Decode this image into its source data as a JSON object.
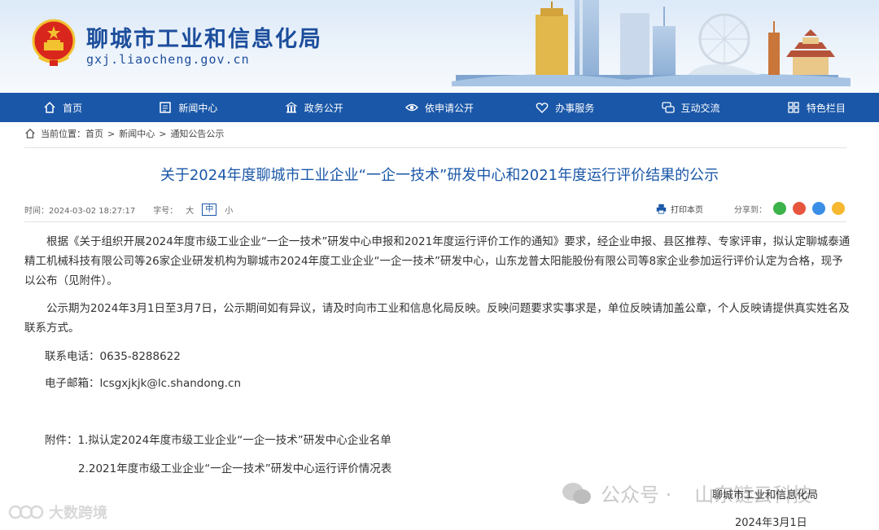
{
  "header": {
    "site_title": "聊城市工业和信息化局",
    "domain": "gxj.liaocheng.gov.cn"
  },
  "nav": [
    {
      "label": "首页",
      "icon": "home-icon"
    },
    {
      "label": "新闻中心",
      "icon": "newspaper-icon"
    },
    {
      "label": "政务公开",
      "icon": "government-icon"
    },
    {
      "label": "依申请公开",
      "icon": "eye-icon"
    },
    {
      "label": "办事服务",
      "icon": "heart-icon"
    },
    {
      "label": "互动交流",
      "icon": "chat-icon"
    },
    {
      "label": "特色栏目",
      "icon": "grid-icon"
    }
  ],
  "breadcrumb": {
    "prefix": "当前位置：",
    "items": [
      "首页",
      "新闻中心",
      "通知公告公示"
    ],
    "separator": ">"
  },
  "article": {
    "title": "关于2024年度聊城市工业企业“一企一技术”研发中心和2021年度运行评价结果的公示",
    "time": "时间：2024-03-02 18:27:17",
    "font_label": "字号：",
    "font_sizes": [
      "大",
      "中",
      "小"
    ],
    "print_label": "打印本页",
    "share_label": "分享到：",
    "share_icons": [
      "wechat-icon",
      "weibo-icon",
      "qq-icon",
      "qzone-icon"
    ],
    "paragraph1": "根据《关于组织开展2024年度市级工业企业“一企一技术”研发中心申报和2021年度运行评价工作的通知》要求，经企业申报、县区推荐、专家评审，拟认定聊城泰通精工机械科技有限公司等26家企业研发机构为聊城市2024年度工业企业“一企一技术”研发中心，山东龙普太阳能股份有限公司等8家企业参加运行评价认定为合格，现予以公布（见附件）。",
    "paragraph2": "公示期为2024年3月1日至3月7日，公示期间如有异议，请及时向市工业和信息化局反映。反映问题要求实事求是，单位反映请加盖公章，个人反映请提供真实姓名及联系方式。",
    "phone": "联系电话：0635-8288622",
    "email": "电子邮箱：lcsgxjkjk@lc.shandong.cn",
    "attachment1": "附件：1.拟认定2024年度市级工业企业“一企一技术”研发中心企业名单",
    "attachment2": "2.2021年度市级工业企业“一企一技术”研发中心运行评价情况表",
    "signature_org": "聊城市工业和信息化局",
    "signature_date": "2024年3月1日"
  },
  "watermarks": {
    "left": "大数跨境",
    "right_prefix": "公众号 ·",
    "right_name": "山东链云科技"
  },
  "colors": {
    "brand_blue": "#1a57a8",
    "title_blue": "#1d4e9c",
    "emblem_red": "#d9261c",
    "emblem_gold": "#f2c230"
  }
}
